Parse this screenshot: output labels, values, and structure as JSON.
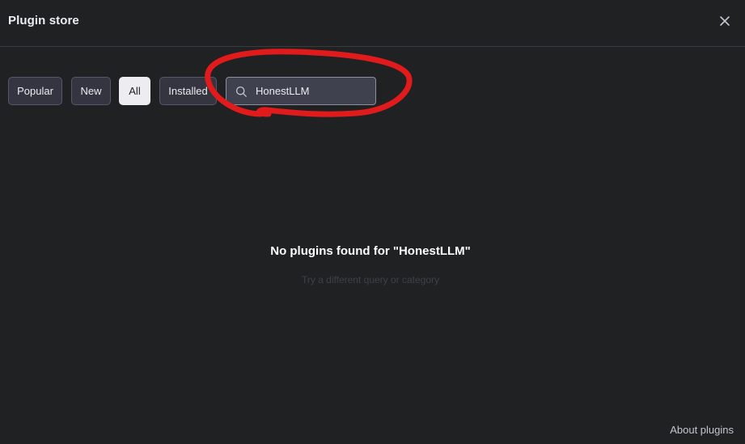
{
  "header": {
    "title": "Plugin store",
    "close_icon": "close-icon"
  },
  "filters": {
    "chips": [
      {
        "label": "Popular",
        "active": false
      },
      {
        "label": "New",
        "active": false
      },
      {
        "label": "All",
        "active": true
      },
      {
        "label": "Installed",
        "active": false
      }
    ]
  },
  "search": {
    "icon": "search-icon",
    "value": "HonestLLM"
  },
  "empty_state": {
    "title": "No plugins found for \"HonestLLM\"",
    "subtitle": "Try a different query or category"
  },
  "footer": {
    "about_label": "About plugins"
  },
  "colors": {
    "background": "#202123",
    "chip_bg": "#343541",
    "chip_active_bg": "#ececf1",
    "annotation_red": "#e11b1b"
  }
}
